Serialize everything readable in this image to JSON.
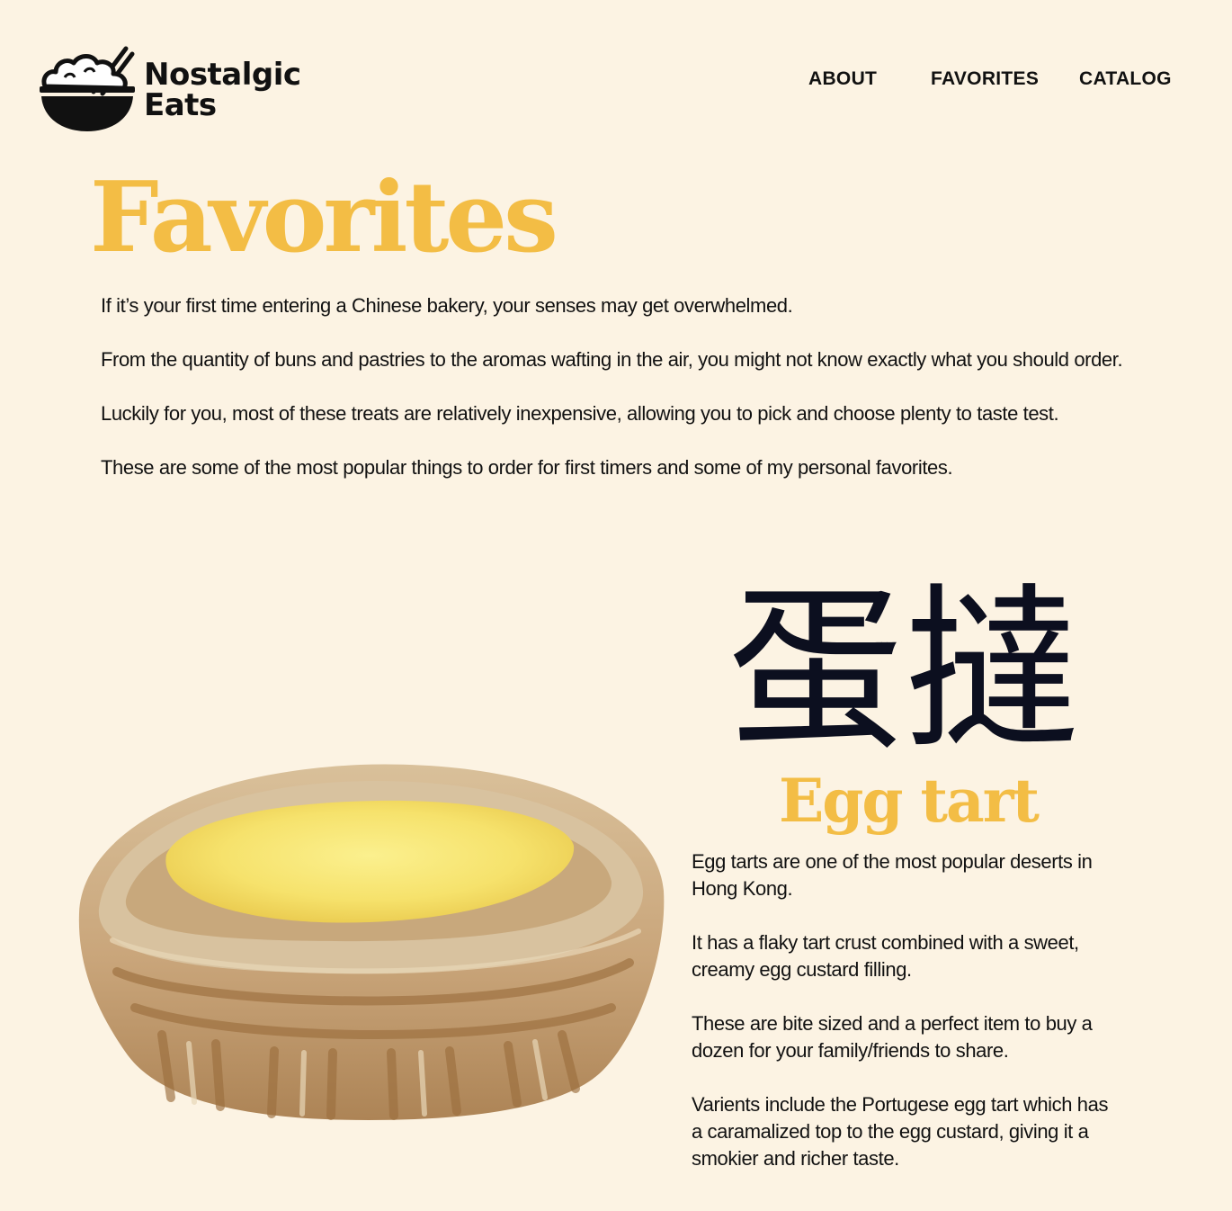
{
  "brand": {
    "line1": "Nostalgic",
    "line2": "Eats",
    "logo_icon": "rice-bowl-chopsticks-icon"
  },
  "nav": {
    "about": "ABOUT",
    "favorites": "FAVORITES",
    "catalog": "CATALOG"
  },
  "page": {
    "title": "Favorites",
    "intro": [
      "If it’s your first time entering a Chinese bakery, your senses may get overwhelmed.",
      "From the quantity of buns and pastries to the aromas wafting in the air, you might not know exactly what you should order.",
      "Luckily for you, most of these treats are relatively inexpensive, allowing you to pick and choose plenty to taste test.",
      "These are some of the most popular things to order for first timers and some of my personal favorites."
    ]
  },
  "feature": {
    "chinese_name": "蛋撻",
    "english_name": "Egg tart",
    "illustration": "egg-tart-illustration",
    "paragraphs": [
      "Egg tarts are one of the most popular deserts in Hong Kong.",
      "It has a flaky tart crust combined with a sweet, creamy egg custard filling.",
      "These are bite sized and a perfect item to buy a dozen for your family/friends to share.",
      "Varients include the Portugese egg tart which has a caramalized top to the egg custard, giving it a smokier and richer taste."
    ]
  },
  "colors": {
    "background": "#fcf3e3",
    "accent": "#f3bd45",
    "text": "#111111",
    "chinese_text": "#0c0f1f"
  }
}
